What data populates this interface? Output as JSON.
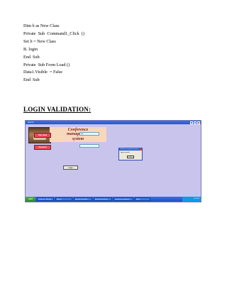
{
  "code_lines": [
    "Dim b as New Class",
    "Private  Sub  Command1_Click  ()",
    "Set b = New Class",
    "B. login",
    "End  Sub",
    "Private  Sub Form Load ()",
    "Data1.Visible  = False",
    "End  Sub"
  ],
  "heading": "LOGIN VALIDATION:",
  "screenshot": {
    "window_title": "Form1",
    "banner_lines": [
      "Conference",
      "management",
      "system"
    ],
    "user_name_label": "User name",
    "password_label": "Password",
    "user_field_value": "abc",
    "password_field_value": "",
    "login_button": "Login",
    "msgbox": {
      "title": "Conference management system",
      "text": "login successful",
      "ok": "OK"
    },
    "taskbar": {
      "start": "start",
      "tasks": [
        "Conference - Microsoft...",
        "Project1",
        "Microsoft Visual Basic...",
        "Microsoft Visual Basic...",
        "Conference management...",
        "Form1"
      ],
      "clock": "2:50 PM"
    }
  }
}
